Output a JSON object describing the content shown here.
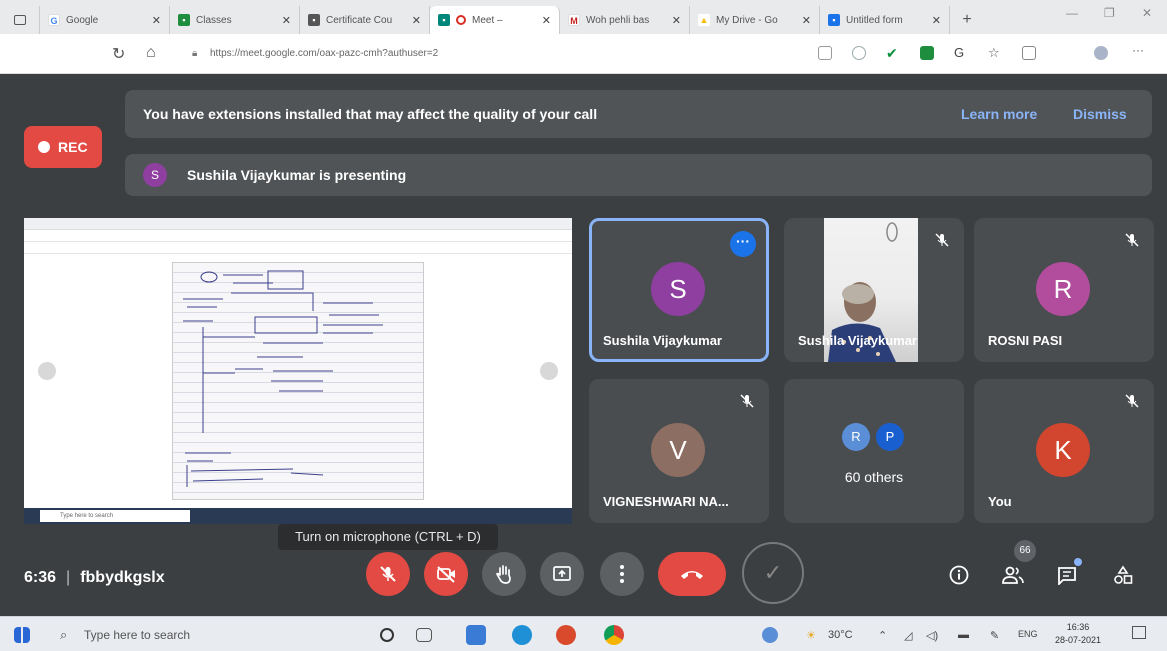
{
  "browser": {
    "tabs": [
      {
        "title": "Google",
        "fav_color": "#4285f4",
        "fav_text": "G"
      },
      {
        "title": "Classes",
        "fav_color": "#1e8e3e",
        "fav_text": "▪"
      },
      {
        "title": "Certificate Cou",
        "fav_color": "#555555",
        "fav_text": "▪"
      },
      {
        "title": "Meet – ",
        "fav_color": "#00897b",
        "fav_text": "▪"
      },
      {
        "title": "Woh pehli bas",
        "fav_color": "#c5221f",
        "fav_text": "M"
      },
      {
        "title": "My Drive - Go",
        "fav_color": "#fbbc04",
        "fav_text": "▲"
      },
      {
        "title": "Untitled form",
        "fav_color": "#1a73e8",
        "fav_text": "▪"
      }
    ],
    "new_tab": "+",
    "url_host": "https://meet.google.com",
    "url_path": "/oax-pazc-cmh?authuser=2"
  },
  "banner": {
    "message": "You have extensions installed that may affect the quality of your call",
    "learn_more": "Learn more",
    "dismiss": "Dismiss"
  },
  "rec": {
    "label": "REC"
  },
  "presenting": {
    "initial": "S",
    "text": "Sushila Vijaykumar is presenting"
  },
  "shared_screen": {
    "taskbar_search": "Type here to search"
  },
  "tiles": [
    {
      "name": "Sushila Vijaykumar",
      "initial": "S",
      "color": "#8e3fa0"
    },
    {
      "name": "Sushila Vijaykumar"
    },
    {
      "name": "ROSNI PASI",
      "initial": "R",
      "color": "#b24c9d"
    },
    {
      "name": "VIGNESHWARI NA...",
      "initial": "V",
      "color": "#8d6e63"
    },
    {
      "name": "60 others",
      "mini": [
        "R",
        "P"
      ]
    },
    {
      "name": "You",
      "initial": "K",
      "color": "#d2462f"
    }
  ],
  "tooltip": "Turn on microphone (CTRL + D)",
  "meeting": {
    "time": "6:36",
    "code": "fbbydkgslx"
  },
  "participants_count": "66",
  "taskbar": {
    "search_placeholder": "Type here to search",
    "temperature": "30°C",
    "language": "ENG",
    "time": "16:36",
    "date": "28-07-2021"
  }
}
